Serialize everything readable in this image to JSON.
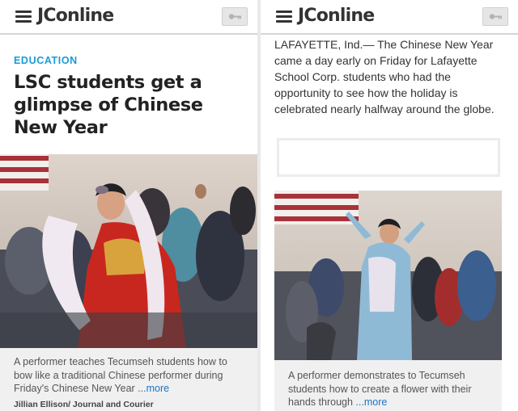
{
  "brand": "JConline",
  "left": {
    "section": "EDUCATION",
    "headline": "LSC students get a glimpse of Chinese New Year",
    "caption": "A performer teaches Tecumseh students how to bow like a traditional Chinese performer during Friday's Chinese New Year",
    "more_label": "...more",
    "credit": "Jillian Ellison/ Journal and Courier"
  },
  "right": {
    "body": "LAFAYETTE, Ind.— The Chinese New Year came a day early on Friday for Lafayette School Corp. students who had the opportunity to see how the holiday is celebrated nearly halfway around the globe.",
    "caption": "A performer demonstrates to Tecumseh students how to create a flower with their hands through",
    "more_label": "...more"
  },
  "icons": [
    "menu-icon",
    "key-icon"
  ],
  "colors": {
    "accent": "#1a9bd7",
    "link": "#1a73c9",
    "text": "#333333"
  }
}
